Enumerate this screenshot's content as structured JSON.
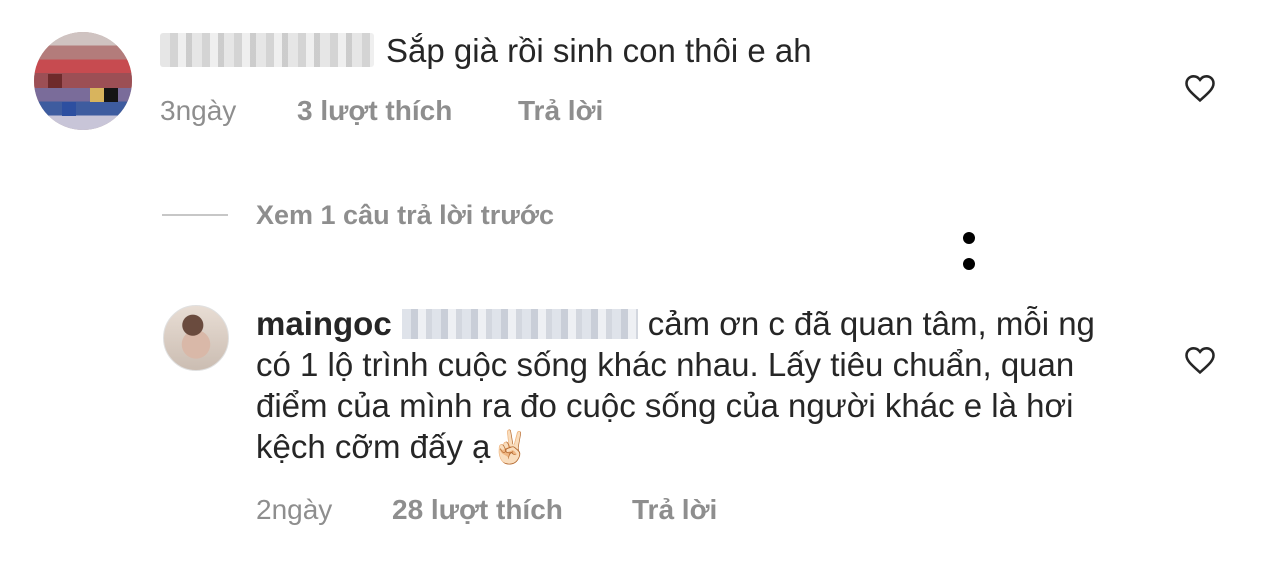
{
  "comments": [
    {
      "text": "Sắp già rồi sinh con thôi e ah",
      "time": "3ngày",
      "likes": "3 lượt thích",
      "reply": "Trả lời"
    }
  ],
  "view_replies": "Xem 1 câu trả lời trước",
  "reply": {
    "username": "maingoc",
    "text_line1": "cảm ơn c đã quan tâm,",
    "text_rest": "mỗi ng có 1 lộ trình cuộc sống khác nhau. Lấy tiêu chuẩn, quan điểm của mình ra đo cuộc sống của người khác e là hơi kệch cỡm đấy ạ",
    "emoji": "✌🏻",
    "time": "2ngày",
    "likes": "28 lượt thích",
    "reply": "Trả lời"
  },
  "icons": {
    "like": "heart-outline-icon",
    "more": "more-options-icon"
  },
  "colors": {
    "text": "#262626",
    "secondary": "#8e8e8e",
    "divider": "#c7c7c7"
  }
}
